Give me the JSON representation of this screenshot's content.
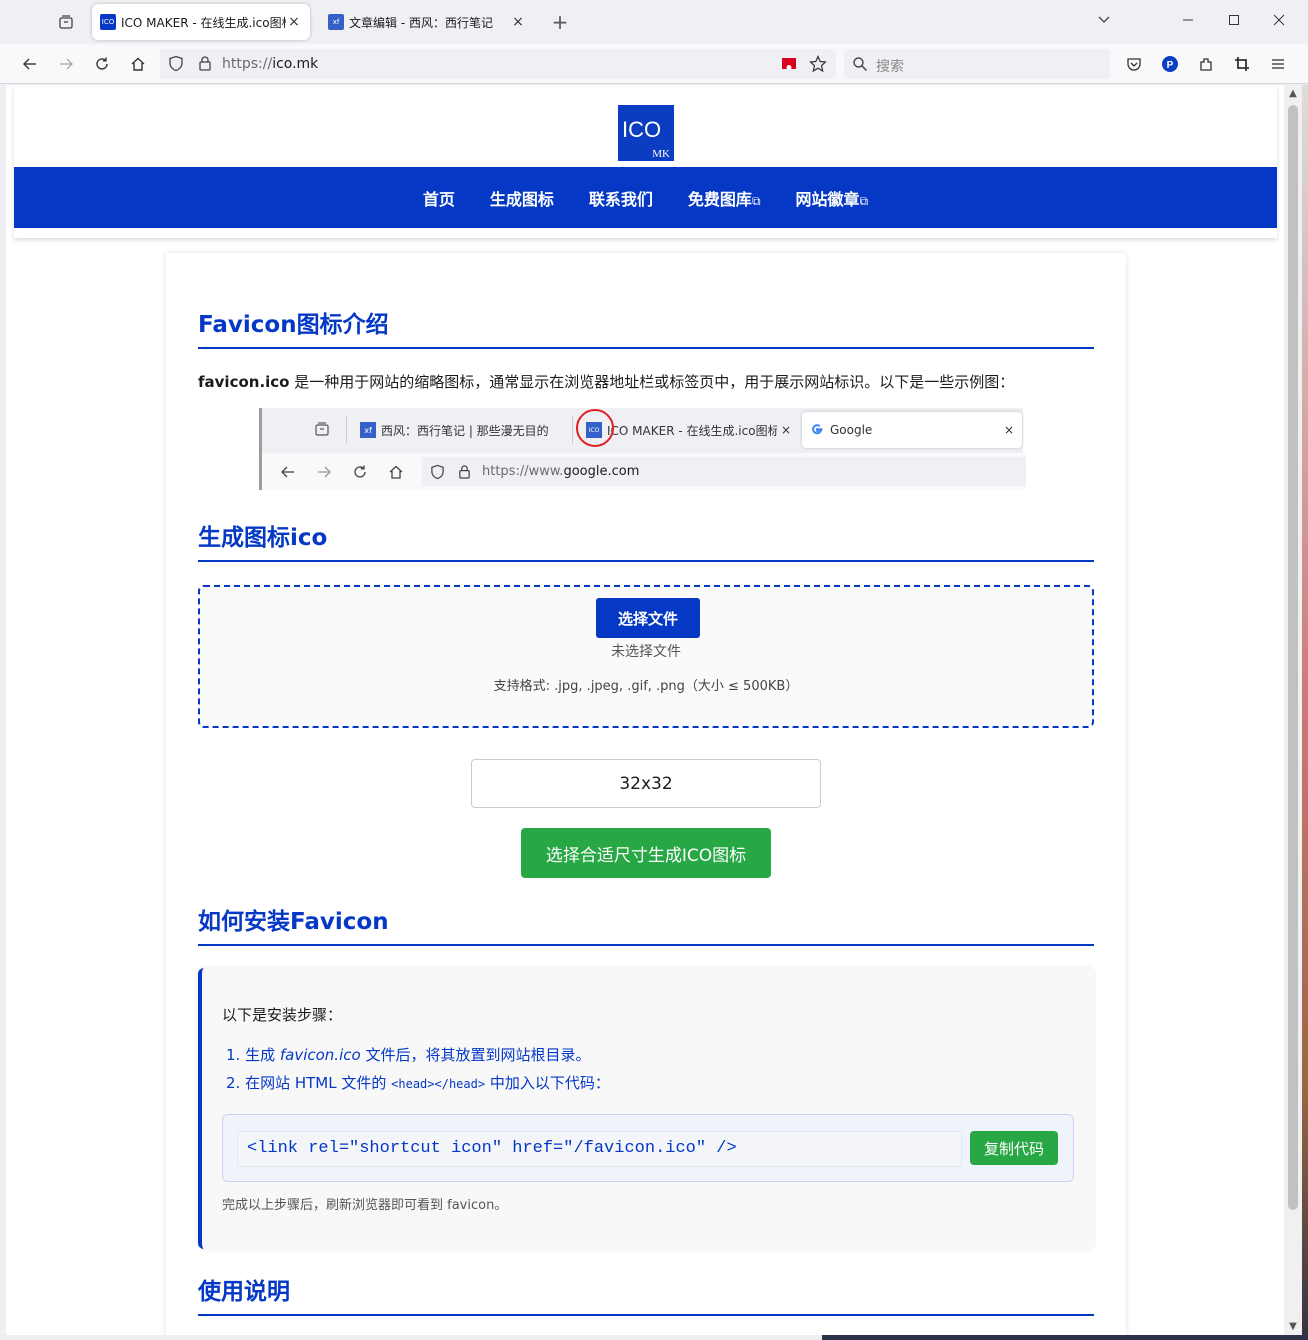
{
  "browser": {
    "tabs": [
      {
        "title": "ICO MAKER - 在线生成.ico图标",
        "favicon": "ICO",
        "favicon_color": "#0438c5",
        "active": true
      },
      {
        "title": "文章编辑 - 西风：西行笔记",
        "favicon": "xf",
        "favicon_color": "#3461c8",
        "active": false
      }
    ],
    "url_protocol": "https://",
    "url_host": "ico.mk",
    "search_placeholder": "搜索"
  },
  "site": {
    "logo_text": "ICO",
    "logo_sub": "MK",
    "menu": [
      {
        "label": "首页",
        "external": false
      },
      {
        "label": "生成图标",
        "external": false
      },
      {
        "label": "联系我们",
        "external": false
      },
      {
        "label": "免费图库",
        "external": true
      },
      {
        "label": "网站徽章",
        "external": true
      }
    ],
    "external_mark": "⧉"
  },
  "intro": {
    "heading": "Favicon图标介绍",
    "term": "favicon.ico",
    "text": " 是一种用于网站的缩略图标，通常显示在浏览器地址栏或标签页中，用于展示网站标识。以下是一些示例图："
  },
  "example": {
    "tabs": [
      "西风：西行笔记 | 那些漫无目的",
      "ICO MAKER - 在线生成.ico图标",
      "Google"
    ],
    "url_protocol": "https://www.",
    "url_host": "google.com"
  },
  "generate": {
    "heading": "生成图标ico",
    "choose_file": "选择文件",
    "no_file": "未选择文件",
    "formats": "支持格式: .jpg, .jpeg, .gif, .png（大小 ≤ 500KB）",
    "size_value": "32x32",
    "generate_button": "选择合适尺寸生成ICO图标"
  },
  "install": {
    "heading": "如何安装Favicon",
    "lead": "以下是安装步骤：",
    "step1_prefix": "1. 生成 ",
    "step1_file": "favicon.ico",
    "step1_suffix": " 文件后，将其放置到网站根目录。",
    "step2_prefix": "2. 在网站 HTML 文件的 ",
    "step2_code": "<head></head>",
    "step2_suffix": " 中加入以下代码：",
    "code": "<link rel=\"shortcut icon\" href=\"/favicon.ico\" />",
    "copy_button": "复制代码",
    "done": "完成以上步骤后，刷新浏览器即可看到 favicon。"
  },
  "usage": {
    "heading": "使用说明"
  }
}
